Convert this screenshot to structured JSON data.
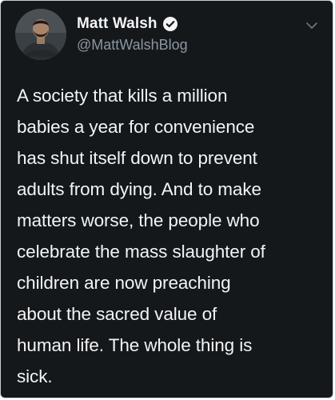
{
  "tweet": {
    "author_name": "Matt Walsh",
    "author_handle": "@MattWalshBlog",
    "text": "A society that kills a million\nbabies a year for convenience\nhas shut itself down to prevent\nadults from dying. And to make\nmatters worse, the people who\ncelebrate the mass slaughter of\nchildren are now preaching\nabout the sacred value of\nhuman life. The whole thing is\nsick."
  },
  "icons": {
    "verified": "verified-badge-icon",
    "menu": "chevron-down-icon"
  },
  "colors": {
    "background": "#15181b",
    "text": "#f2f4f5",
    "handle": "#8b979f",
    "border": "#c9cdd1"
  }
}
